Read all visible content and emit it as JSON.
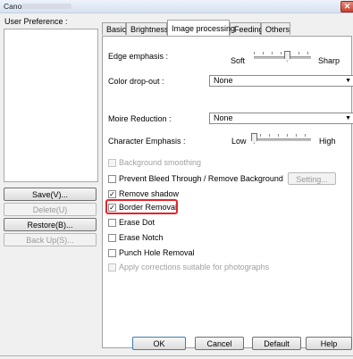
{
  "window": {
    "title": "Canon"
  },
  "left": {
    "user_pref_label": "User Preference :",
    "buttons": [
      "Save(V)...",
      "Delete(U)",
      "Restore(B)...",
      "Back Up(S)..."
    ]
  },
  "tabs": [
    "Basic",
    "Brightness",
    "Image processing",
    "Feeding",
    "Others"
  ],
  "panel": {
    "edge_emphasis": {
      "label": "Edge emphasis :",
      "left": "Soft",
      "right": "Sharp",
      "level": 0.6
    },
    "color_dropout": {
      "label": "Color drop-out :",
      "value": "None"
    },
    "moire": {
      "label": "Moire Reduction :",
      "value": "None"
    },
    "char_emphasis": {
      "label": "Character Emphasis :",
      "left": "Low",
      "right": "High",
      "level": 0.0
    },
    "checks": [
      {
        "label": "Background smoothing",
        "checked": false,
        "enabled": false
      },
      {
        "label": "Prevent Bleed Through / Remove Background",
        "checked": false,
        "enabled": true
      },
      {
        "label": "Remove shadow",
        "checked": true,
        "enabled": true
      },
      {
        "label": "Border Removal",
        "checked": true,
        "enabled": true
      },
      {
        "label": "Erase Dot",
        "checked": false,
        "enabled": true
      },
      {
        "label": "Erase Notch",
        "checked": false,
        "enabled": true
      },
      {
        "label": "Punch Hole Removal",
        "checked": false,
        "enabled": true
      },
      {
        "label": "Apply corrections suitable for photographs",
        "checked": false,
        "enabled": false
      }
    ],
    "setting_button": "Setting..."
  },
  "footer": {
    "ok": "OK",
    "cancel": "Cancel",
    "default": "Default",
    "help": "Help"
  },
  "colors": {
    "highlight": "#e3242b",
    "window_bg": "#f0f0f0"
  },
  "icons": {
    "close": "close-icon",
    "dropdown": "chevron-down-icon",
    "check": "checkmark"
  }
}
